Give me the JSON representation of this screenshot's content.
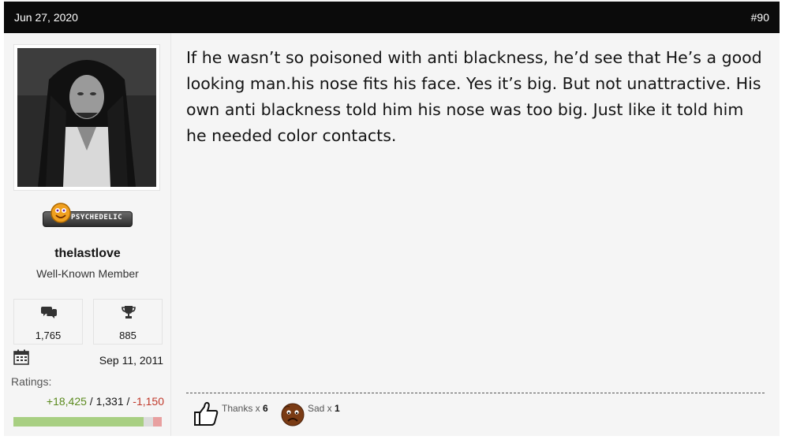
{
  "post": {
    "date": "Jun 27, 2020",
    "number": "#90"
  },
  "user": {
    "avatar_icon": "user-avatar-photo",
    "badge_text": "PSYCHEDELIC",
    "username": "thelastlove",
    "title": "Well-Known Member",
    "messages": "1,765",
    "trophy_points": "885",
    "joined": "Sep 11, 2011",
    "ratings_label": "Ratings:",
    "ratings_positive": "+18,425",
    "ratings_neutral": "1,331",
    "ratings_negative": "-1,150",
    "ratings_separator": " / ",
    "rating_bar_fraction": {
      "positive": 0.88,
      "neutral": 0.06,
      "negative": 0.06
    }
  },
  "message": {
    "text": "If he wasn’t so poisoned with anti blackness, he’d see that He’s a good looking man.his nose fits his face. Yes it’s big. But not unattractive. His own anti blackness told him his nose was too big. Just like it told him he needed color contacts."
  },
  "reactions": [
    {
      "icon": "thumbs-up-icon",
      "label": "Thanks x ",
      "count": "6"
    },
    {
      "icon": "sad-face-icon",
      "label": "Sad x ",
      "count": "1"
    }
  ],
  "colors": {
    "header_bg": "#0b0b0b",
    "positive": "#5b8a1e",
    "negative": "#c0392b"
  }
}
